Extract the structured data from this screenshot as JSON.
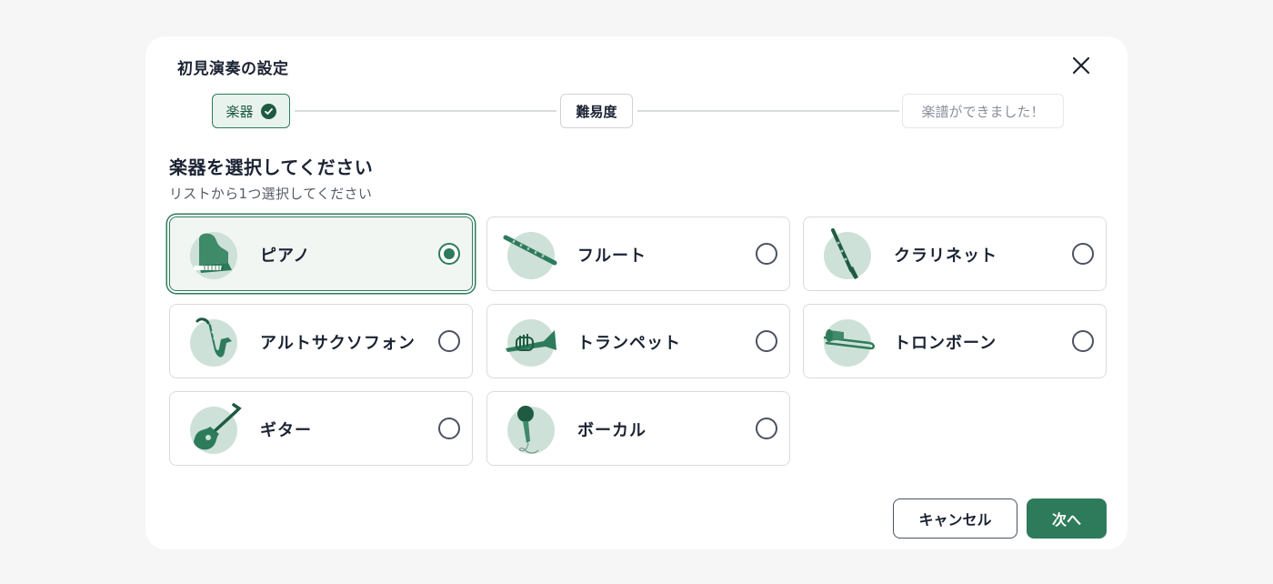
{
  "dialog": {
    "title": "初見演奏の設定",
    "close_icon": "close-icon"
  },
  "stepper": {
    "steps": [
      {
        "label": "楽器",
        "state": "done",
        "icon": "check-circle-icon"
      },
      {
        "label": "難易度",
        "state": "current"
      },
      {
        "label": "楽譜ができました！",
        "state": "upcoming"
      }
    ]
  },
  "section": {
    "heading": "楽器を選択してください",
    "subheading": "リストから1つ選択してください"
  },
  "instruments": [
    {
      "label": "ピアノ",
      "icon": "piano-icon",
      "selected": true
    },
    {
      "label": "フルート",
      "icon": "flute-icon",
      "selected": false
    },
    {
      "label": "クラリネット",
      "icon": "clarinet-icon",
      "selected": false
    },
    {
      "label": "アルトサクソフォン",
      "icon": "saxophone-icon",
      "selected": false
    },
    {
      "label": "トランペット",
      "icon": "trumpet-icon",
      "selected": false
    },
    {
      "label": "トロンボーン",
      "icon": "trombone-icon",
      "selected": false
    },
    {
      "label": "ギター",
      "icon": "guitar-icon",
      "selected": false
    },
    {
      "label": "ボーカル",
      "icon": "microphone-icon",
      "selected": false
    }
  ],
  "footer": {
    "cancel_label": "キャンセル",
    "next_label": "次へ"
  },
  "colors": {
    "accent": "#2e7b5b",
    "accent_light": "#cde1d8",
    "selected_bg": "#f1f6f3",
    "text": "#1b2333"
  }
}
